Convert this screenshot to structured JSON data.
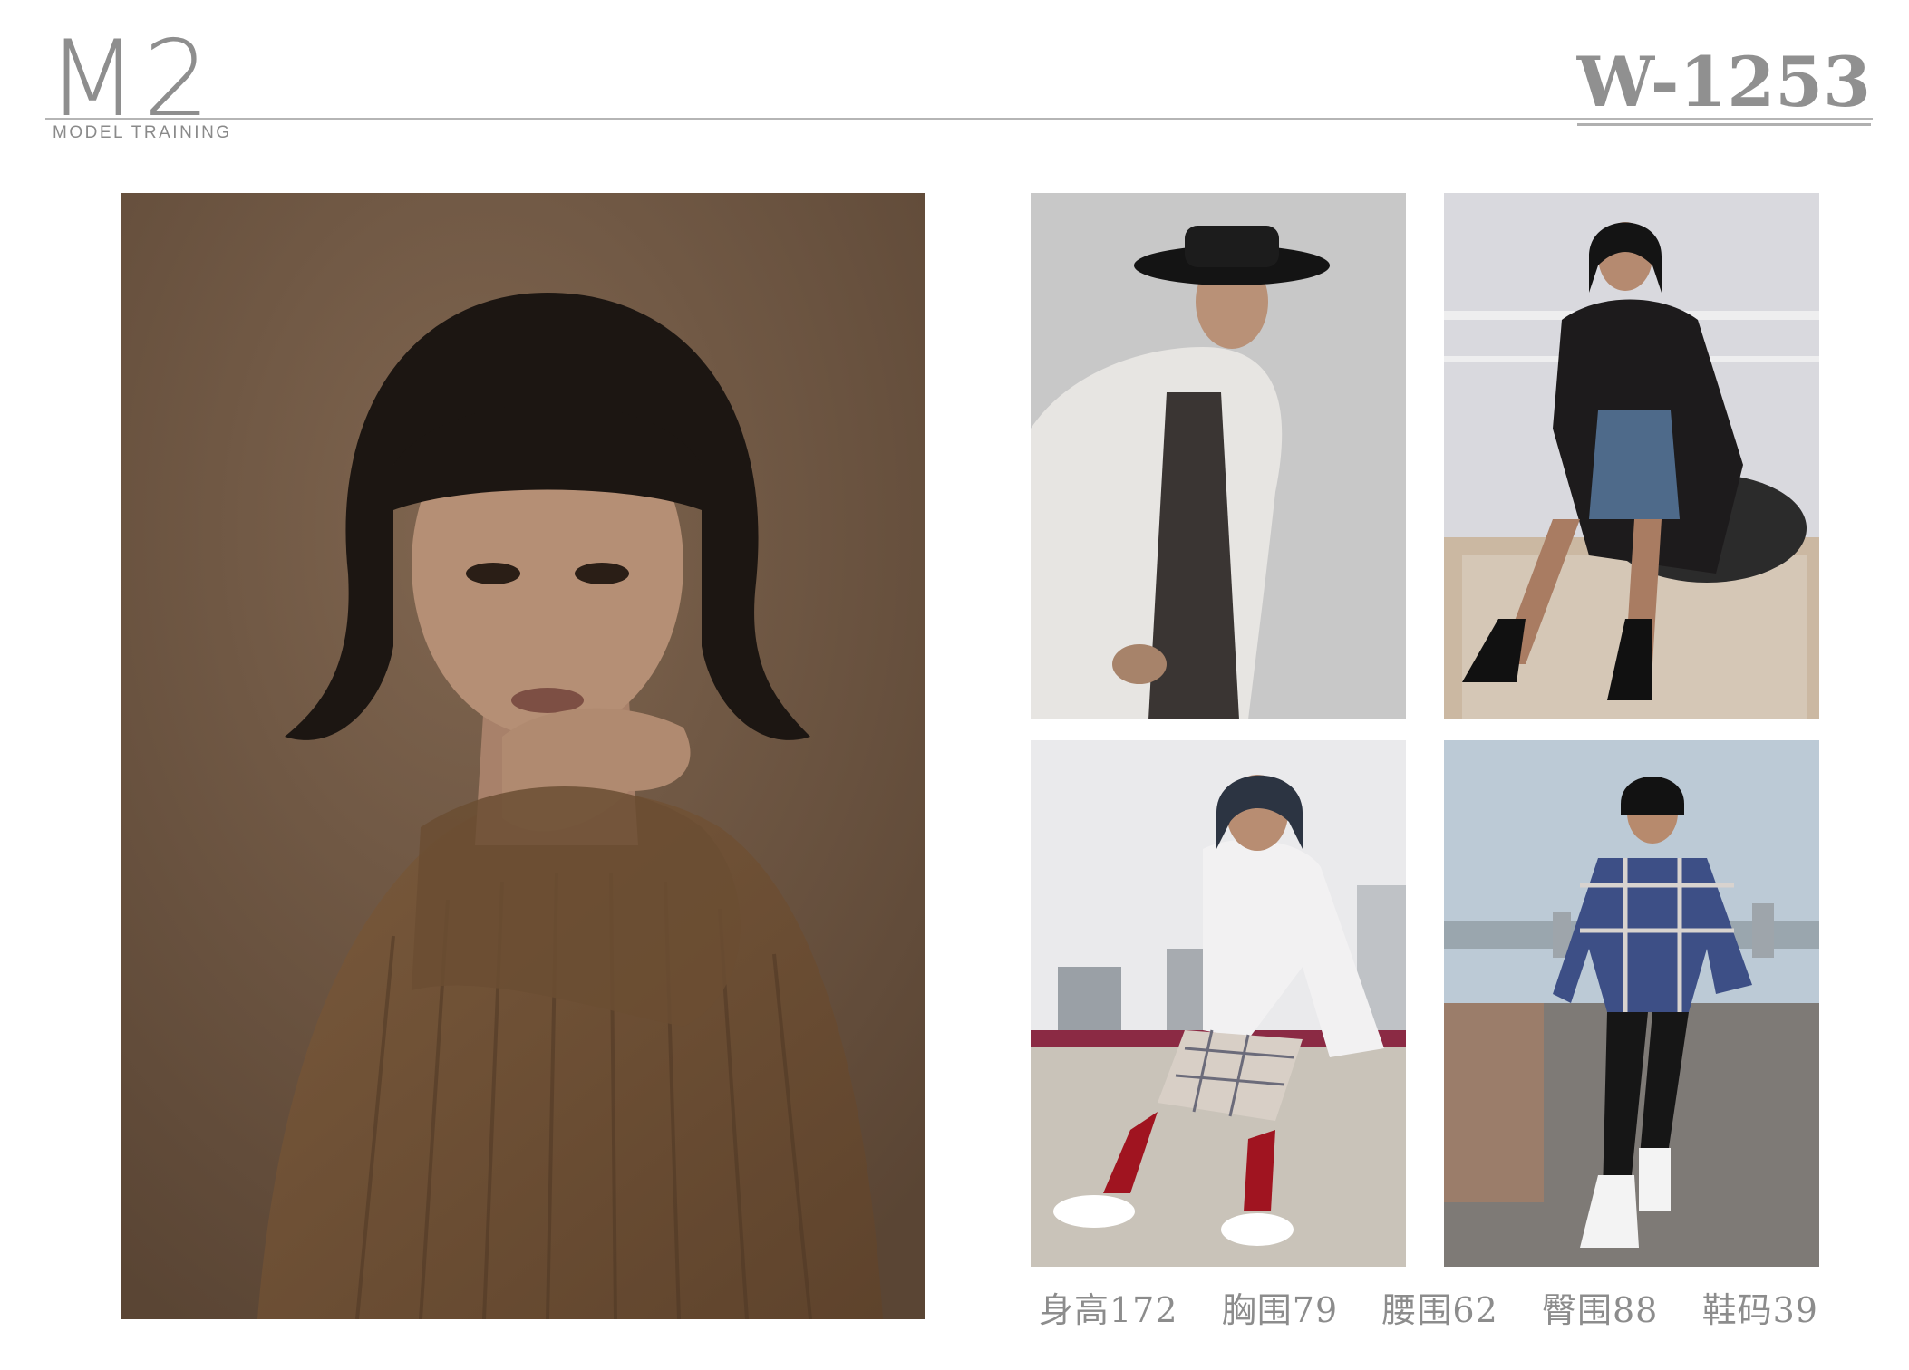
{
  "header": {
    "logo_mark": "M2",
    "logo_subtitle": "MODEL TRAINING",
    "model_code": "W-1253"
  },
  "photos": [
    {
      "slot": "main",
      "icon": "portrait-photo"
    },
    {
      "slot": "top-left",
      "icon": "fashion-photo"
    },
    {
      "slot": "top-right",
      "icon": "fashion-photo"
    },
    {
      "slot": "bottom-left",
      "icon": "fashion-photo"
    },
    {
      "slot": "bottom-right",
      "icon": "fashion-photo"
    }
  ],
  "measurements": {
    "height": "身高172",
    "bust": "胸围79",
    "waist": "腰围62",
    "hips": "臀围88",
    "shoe": "鞋码39"
  },
  "colors": {
    "logo_gray": "#8e8e8e",
    "rule_gray": "#b5b5b5",
    "text_gray": "#8c8c8c"
  }
}
